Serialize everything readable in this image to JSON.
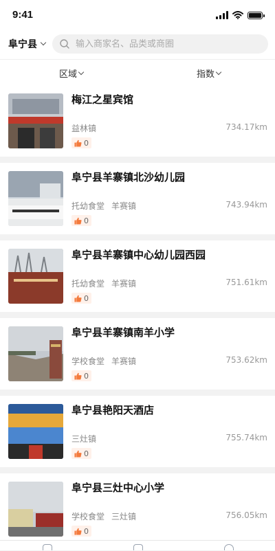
{
  "status_bar": {
    "time": "9:41"
  },
  "header": {
    "county_label": "阜宁县",
    "search_placeholder": "输入商家名、品类或商圈"
  },
  "filters": {
    "region_label": "区域",
    "index_label": "指数"
  },
  "colors": {
    "accent": "#f47a3c",
    "like_bg": "#fff1ea"
  },
  "items": [
    {
      "name": "梅江之星宾馆",
      "tags": [
        "益林镇"
      ],
      "distance": "734.17km",
      "likes": "0"
    },
    {
      "name": "阜宁县羊寨镇北沙幼儿园",
      "tags": [
        "托幼食堂",
        "羊赛镇"
      ],
      "distance": "743.94km",
      "likes": "0"
    },
    {
      "name": "阜宁县羊寨镇中心幼儿园西园",
      "tags": [
        "托幼食堂",
        "羊赛镇"
      ],
      "distance": "751.61km",
      "likes": "0"
    },
    {
      "name": "阜宁县羊寨镇南羊小学",
      "tags": [
        "学校食堂",
        "羊赛镇"
      ],
      "distance": "753.62km",
      "likes": "0"
    },
    {
      "name": "阜宁县艳阳天酒店",
      "tags": [
        "三灶镇"
      ],
      "distance": "755.74km",
      "likes": "0"
    },
    {
      "name": "阜宁县三灶中心小学",
      "tags": [
        "学校食堂",
        "三灶镇"
      ],
      "distance": "756.05km",
      "likes": "0"
    }
  ]
}
